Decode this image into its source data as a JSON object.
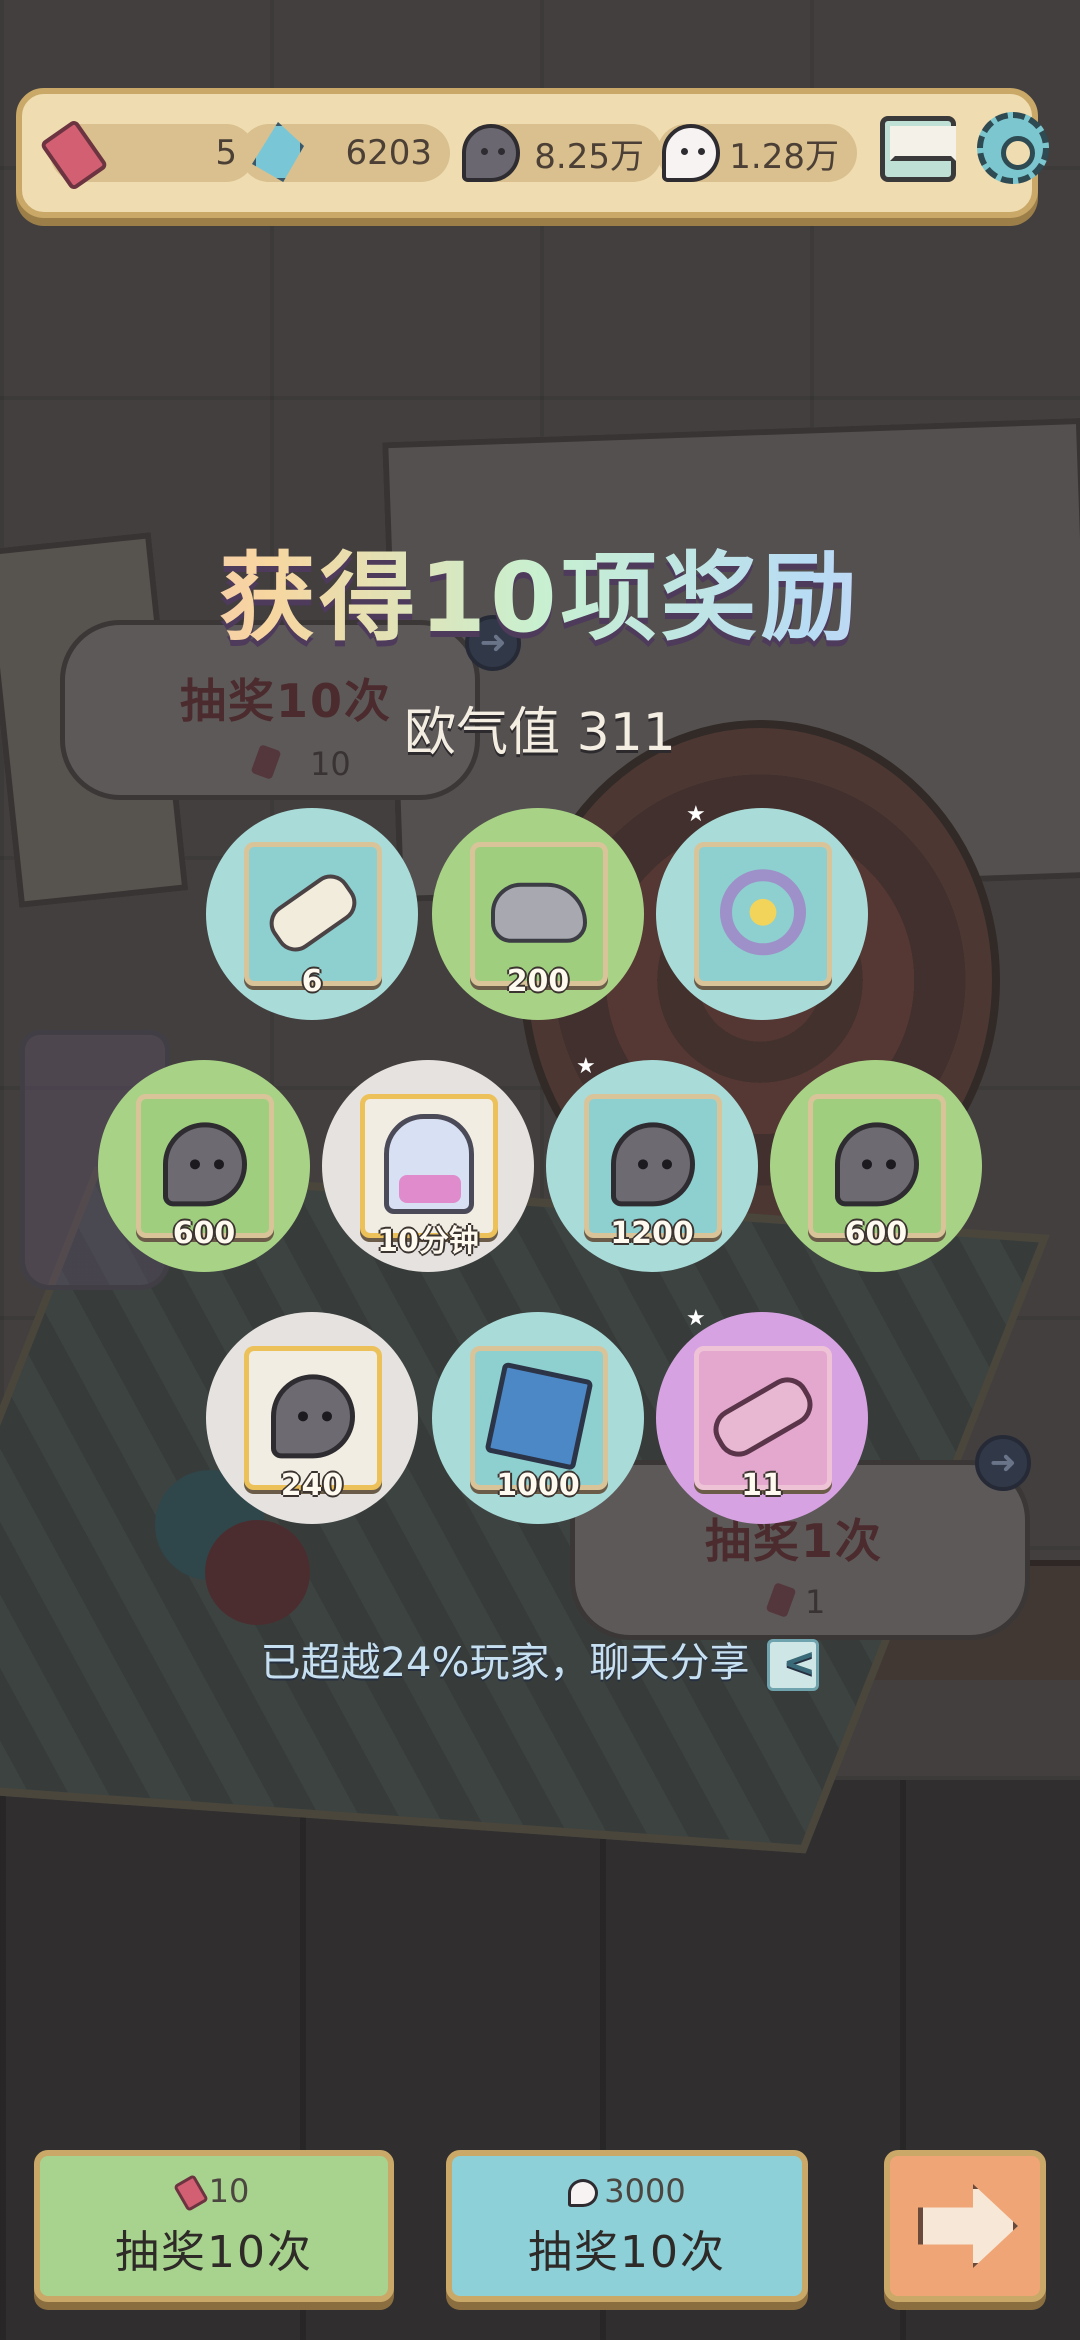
{
  "resources": {
    "tickets": "5",
    "crystals": "6203",
    "dark_spirits": "8.25万",
    "light_spirits": "1.28万"
  },
  "background": {
    "draw10": {
      "label": "抽奖10次",
      "cost": "10"
    },
    "draw1": {
      "label": "抽奖1次",
      "cost": "1"
    }
  },
  "title": "获得10项奖励",
  "luck": {
    "label": "欧气值",
    "value": "311"
  },
  "rewards": [
    {
      "item": "scroll-icon",
      "qty": "6",
      "rarity": "blue"
    },
    {
      "item": "stone-icon",
      "qty": "200",
      "rarity": "green"
    },
    {
      "item": "ring-icon",
      "qty": "",
      "rarity": "blue"
    },
    {
      "item": "dark-spirit-icon",
      "qty": "600",
      "rarity": "green"
    },
    {
      "item": "ghost-card-icon",
      "qty": "10分钟",
      "rarity": "white"
    },
    {
      "item": "dark-spirit-icon",
      "qty": "1200",
      "rarity": "blue"
    },
    {
      "item": "dark-spirit-icon",
      "qty": "600",
      "rarity": "green"
    },
    {
      "item": "dark-spirit-icon",
      "qty": "240",
      "rarity": "white"
    },
    {
      "item": "banner-icon",
      "qty": "1000",
      "rarity": "blue"
    },
    {
      "item": "cannon-icon",
      "qty": "11",
      "rarity": "purple"
    }
  ],
  "share": {
    "text": "已超越24%玩家，聊天分享"
  },
  "buttons": {
    "ticket_draw": {
      "cost": "10",
      "label": "抽奖10次"
    },
    "spirit_draw": {
      "cost": "3000",
      "label": "抽奖10次"
    }
  },
  "colors": {
    "top_bar": "#efdcb1",
    "green_button": "#a8d38e",
    "blue_button": "#8ed0d8",
    "next_button": "#f0a576"
  }
}
